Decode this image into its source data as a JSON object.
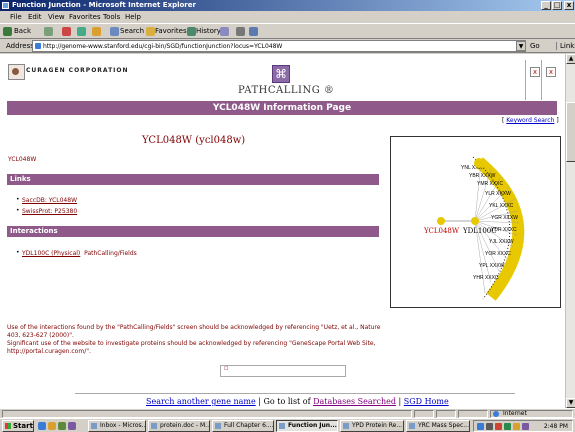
{
  "window": {
    "title": "Function Junction - Microsoft Internet Explorer",
    "min": "_",
    "max": "□",
    "close": "x"
  },
  "menu": [
    "File",
    "Edit",
    "View",
    "Favorites",
    "Tools",
    "Help"
  ],
  "toolbar": {
    "back": "Back",
    "search": "Search",
    "favorites": "Favorites",
    "history": "History"
  },
  "address": {
    "label": "Address",
    "url": "http://genome-www.stanford.edu/cgi-bin/SGD/functionJunction?locus=YCL048W",
    "go": "Go",
    "links": "Links"
  },
  "page": {
    "company": "CURAGEN CORPORATION",
    "brand": "PATHCALLING ®",
    "banner": "YCL048W Information Page",
    "keyword_prefix": "[ ",
    "keyword_link": "Keyword Search",
    "keyword_suffix": " ]",
    "gene_heading": "YCL048W  (ycl048w)",
    "gene_sub": "YCL048W",
    "links_section": "Links",
    "links": [
      "SaccDB: YCL048W",
      "SwissProt: P25380"
    ],
    "interactions_section": "Interactions",
    "interaction": {
      "link": "YDL100C  (Physical)",
      "source": "PathCalling/Fields"
    },
    "ack1": "Use of the interactions found by the \"PathCalling/Fields\" screen should be acknowledged by referencing \"Uetz, et al., Nature 403, 623-627 (2000)\".",
    "ack2": "Significant use of the website to investigate proteins should be acknowledged by referencing \"GeneScape Portal Web Site, http://portal.curagen.com/\".",
    "search_box": "☐",
    "footer": {
      "search_link": "Search another gene name",
      "sep1": " | Go to list of ",
      "db_link": "Databases Searched",
      "sep2": " | ",
      "home_link": "SGD Home"
    }
  },
  "graph": {
    "center_label": "YCL048W",
    "hub_label": "YDL100C"
  },
  "status": {
    "zone": "Internet"
  },
  "taskbar": {
    "start": "Start",
    "tasks": [
      "Inbox - Micros...",
      "protein.doc - M...",
      "Full Chapter 6....",
      "Function Jun...",
      "YPD Protein Re...",
      "YRC Mass Spec..."
    ],
    "clock": "2:48 PM"
  }
}
